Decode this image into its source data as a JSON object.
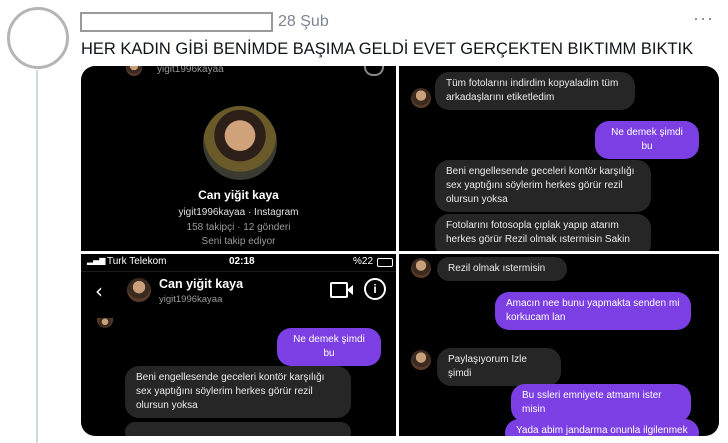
{
  "tweet": {
    "date": "28 Şub",
    "more": "···",
    "text": "HER KADIN GİBİ BENİMDE BAŞIMA GELDİ EVET GERÇEKTEN BIKTIMM BIKTIK"
  },
  "panel_profile": {
    "top_username": "yigit1996kayaa",
    "name": "Can yiğit kaya",
    "subtitle": "yigit1996kayaa · Instagram",
    "stats": "158 takipçi · 12 gönderi",
    "follow_note": "Seni takip ediyor"
  },
  "panel_chat_top": {
    "messages": [
      {
        "from": "them",
        "text": "Tüm fotolarını indirdim kopyaladim tüm arkadaşlarını etiketledim"
      },
      {
        "from": "me",
        "text": "Ne demek şimdi bu"
      },
      {
        "from": "them",
        "text": "Beni engellesende geceleri kontör karşılığı sex yaptığını söylerim herkes görür rezil olursun yoksa"
      },
      {
        "from": "them",
        "text": "Fotolarını fotosopla çıplak yapıp atarım herkes görür Rezil olmak ıstermisin Sakin"
      }
    ]
  },
  "panel_chat_screen": {
    "status": {
      "carrier": "Turk Telekom",
      "time": "02:18",
      "battery": "%22"
    },
    "header_name": "Can yiğit kaya",
    "header_username": "yigit1996kayaa",
    "messages": [
      {
        "from": "me",
        "text": "Ne demek şimdi bu"
      },
      {
        "from": "them",
        "text": "Beni engellesende geceleri kontör karşılığı sex yaptığını söylerim herkes görür rezil olursun yoksa"
      }
    ]
  },
  "panel_chat_bottom": {
    "messages": [
      {
        "from": "them",
        "text": "Rezil olmak ıstermisin"
      },
      {
        "from": "me",
        "text": "Amacın nee bunu yapmakta senden mi korkucam lan"
      },
      {
        "from": "them",
        "text": "Paylaşıyorum Izle şimdi"
      },
      {
        "from": "me",
        "text": "Bu ssleri emniyete atmamı ister misin"
      },
      {
        "from": "me",
        "text": "Yada abim jandarma onunla ilgilenmek"
      }
    ]
  },
  "colors": {
    "bubble_me": "#7b3fe4",
    "bubble_them": "#262626",
    "text": "#0f1419",
    "muted": "#7a8590"
  },
  "icons": [
    "back-chevron-icon",
    "video-call-icon",
    "info-icon",
    "more-dots-icon"
  ]
}
